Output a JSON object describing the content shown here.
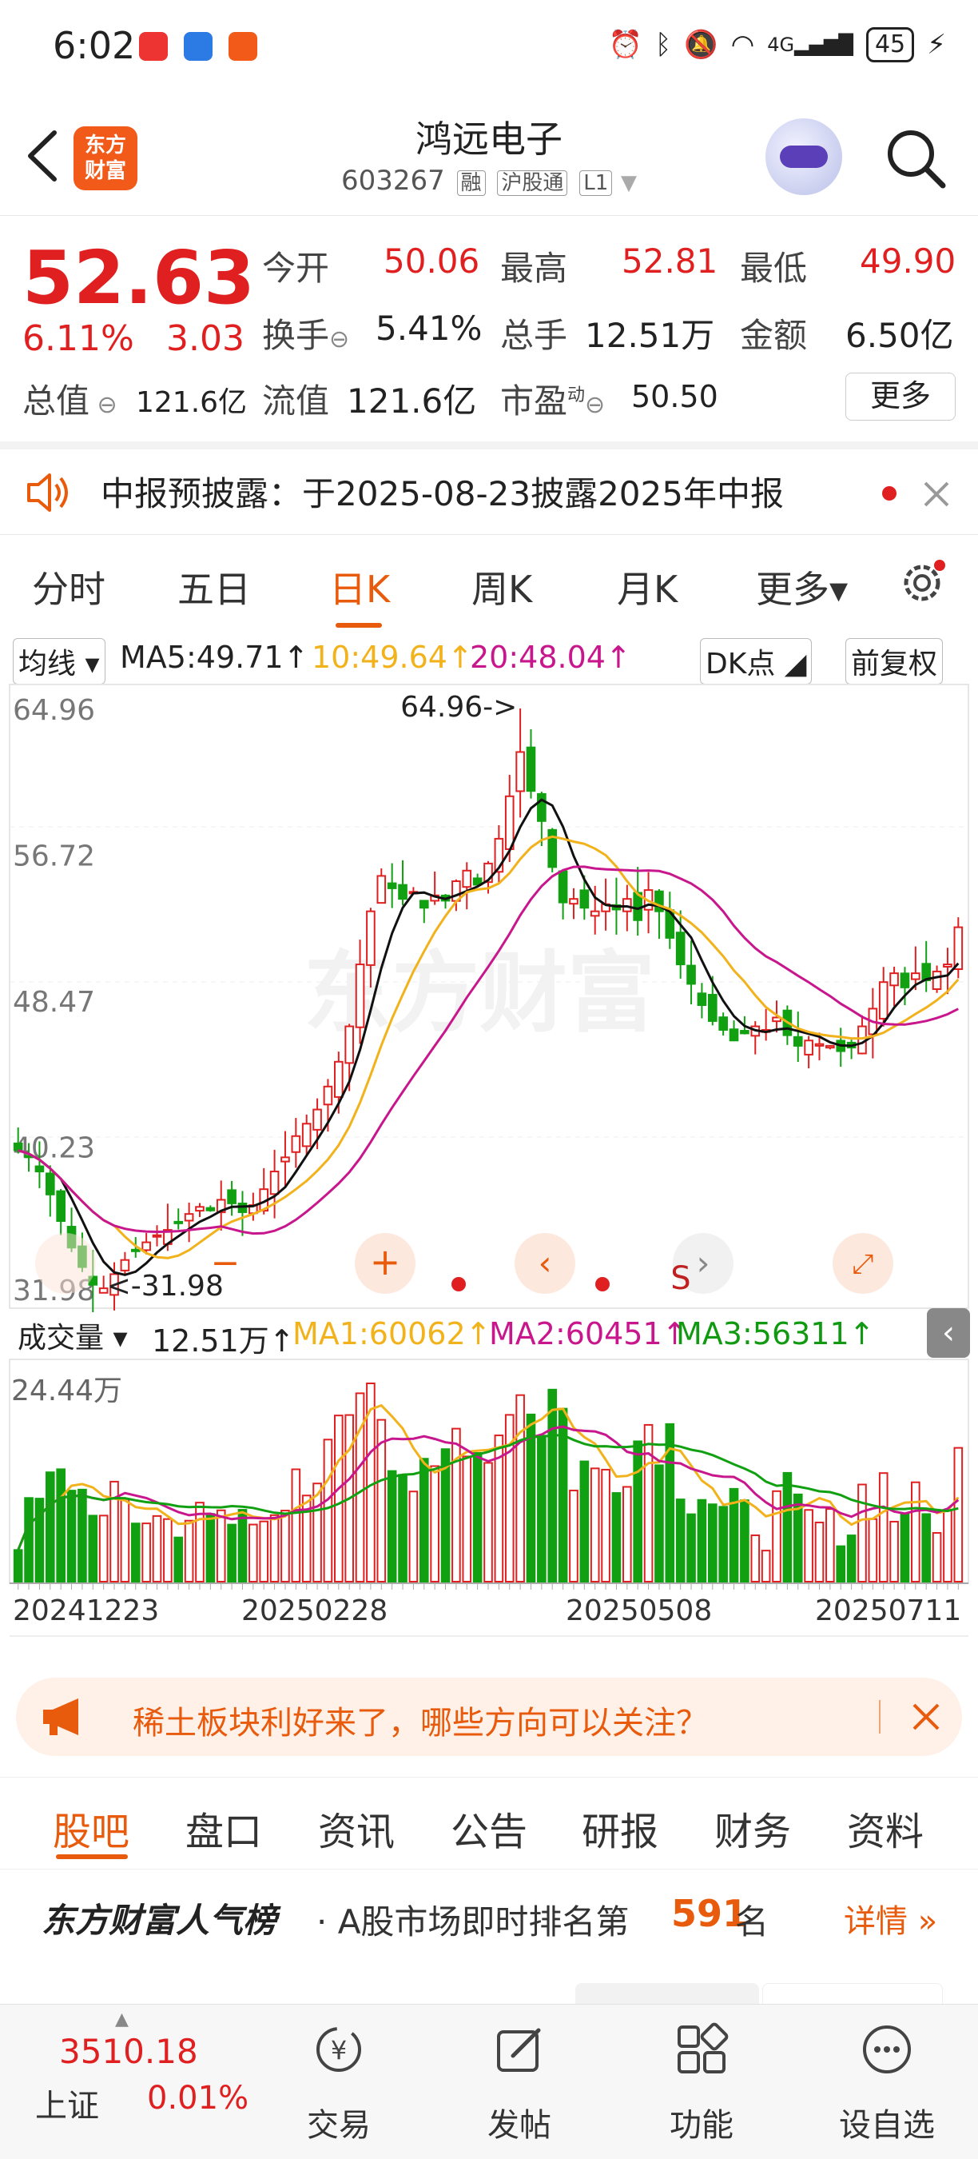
{
  "status_bar": {
    "time": "6:02",
    "battery": "45",
    "network": "4G"
  },
  "header": {
    "logo_text": [
      "东方",
      "财富"
    ],
    "stock_name": "鸿远电子",
    "stock_code": "603267",
    "tags": [
      "融",
      "沪股通",
      "L1"
    ]
  },
  "quote": {
    "price": "52.63",
    "change_pct": "6.11%",
    "change": "3.03",
    "open_label": "今开",
    "open": "50.06",
    "high_label": "最高",
    "high": "52.81",
    "low_label": "最低",
    "low": "49.90",
    "turnover_label": "换手",
    "turnover": "5.41%",
    "volume_label": "总手",
    "volume": "12.51万",
    "amount_label": "金额",
    "amount": "6.50亿",
    "mktcap_label": "总值",
    "mktcap": "121.6亿",
    "float_label": "流值",
    "float_cap": "121.6亿",
    "pe_label": "市盈",
    "pe_sup": "动",
    "pe": "50.50",
    "more_label": "更多"
  },
  "notice": {
    "text": "中报预披露：于2025-08-23披露2025年中报"
  },
  "chart_tabs": {
    "items": [
      "分时",
      "五日",
      "日K",
      "周K",
      "月K",
      "更多▾"
    ],
    "active": "日K"
  },
  "kline_header": {
    "indicator": "均线",
    "ma5": "MA5:49.71↑",
    "ma10": "10:49.64↑",
    "ma20": "20:48.04↑",
    "dk_label": "DK点",
    "adjust_label": "前复权"
  },
  "kline_axis": {
    "y_labels": [
      "64.96",
      "56.72",
      "48.47",
      "40.23",
      "31.98"
    ],
    "max_annotation": "64.96->",
    "min_annotation": "<-31.98",
    "ylim": [
      31.98,
      64.96
    ]
  },
  "volume_header": {
    "indicator": "成交量",
    "vol": "12.51万↑",
    "ma1": "MA1:60062↑",
    "ma2": "MA2:60451↑",
    "ma3": "MA3:56311↑",
    "max_label": "24.44万"
  },
  "x_axis_dates": [
    "20241223",
    "20250228",
    "20250508",
    "20250711"
  ],
  "colors": {
    "up": "#e02020",
    "down": "#11a011",
    "ma5": "#111111",
    "ma10": "#f2b21b",
    "ma20": "#c8168c",
    "accent": "#e85a0c"
  },
  "chart_data": {
    "type": "candlestick",
    "title": "",
    "close_series_approx": [
      40.0,
      39.6,
      38.8,
      37.5,
      36.0,
      34.5,
      33.4,
      32.4,
      32.2,
      33.0,
      33.8,
      34.3,
      34.8,
      35.2,
      35.5,
      35.9,
      36.4,
      36.8,
      36.6,
      37.2,
      37.0,
      36.5,
      36.9,
      37.8,
      38.8,
      39.6,
      40.8,
      41.5,
      42.3,
      43.6,
      45.0,
      47.0,
      50.5,
      53.5,
      55.5,
      54.8,
      54.2,
      54.6,
      53.7,
      54.4,
      54.1,
      55.2,
      55.8,
      55.0,
      56.2,
      57.6,
      60.0,
      62.5,
      60.3,
      58.6,
      56.0,
      54.0,
      54.2,
      53.7,
      53.5,
      53.9,
      53.6,
      54.2,
      53.0,
      54.7,
      53.5,
      52.0,
      50.5,
      49.4,
      48.2,
      47.3,
      46.8,
      46.2,
      46.6,
      47.0,
      46.8,
      47.5,
      46.5,
      45.9,
      46.2,
      46.0,
      45.9,
      45.6,
      45.8,
      47.0,
      48.0,
      49.5,
      50.0,
      49.2,
      50.0,
      49.6,
      50.1,
      50.5,
      52.6
    ],
    "ylim": [
      31.98,
      64.96
    ],
    "max_price": 64.96,
    "min_price": 31.98,
    "volume_max": "24.44万",
    "x_ticks": [
      "20241223",
      "20250228",
      "20250508",
      "20250711"
    ],
    "series": [
      {
        "name": "MA5",
        "last": 49.71
      },
      {
        "name": "MA10",
        "last": 49.64
      },
      {
        "name": "MA20",
        "last": 48.04
      }
    ]
  },
  "banner": {
    "text": "稀土板块利好来了，哪些方向可以关注？"
  },
  "sub_tabs": {
    "items": [
      "股吧",
      "盘口",
      "资讯",
      "公告",
      "研报",
      "财务",
      "资料"
    ],
    "active": "股吧"
  },
  "rank": {
    "brand": "东方财富人气榜",
    "prefix": "· A股市场即时排名第",
    "rank": "591",
    "suffix": "名",
    "detail": "详情"
  },
  "bottom_nav": {
    "index_value": "3510.18",
    "index_name": "上证",
    "index_change": "0.01%",
    "items": [
      "交易",
      "发帖",
      "功能",
      "设自选"
    ]
  }
}
